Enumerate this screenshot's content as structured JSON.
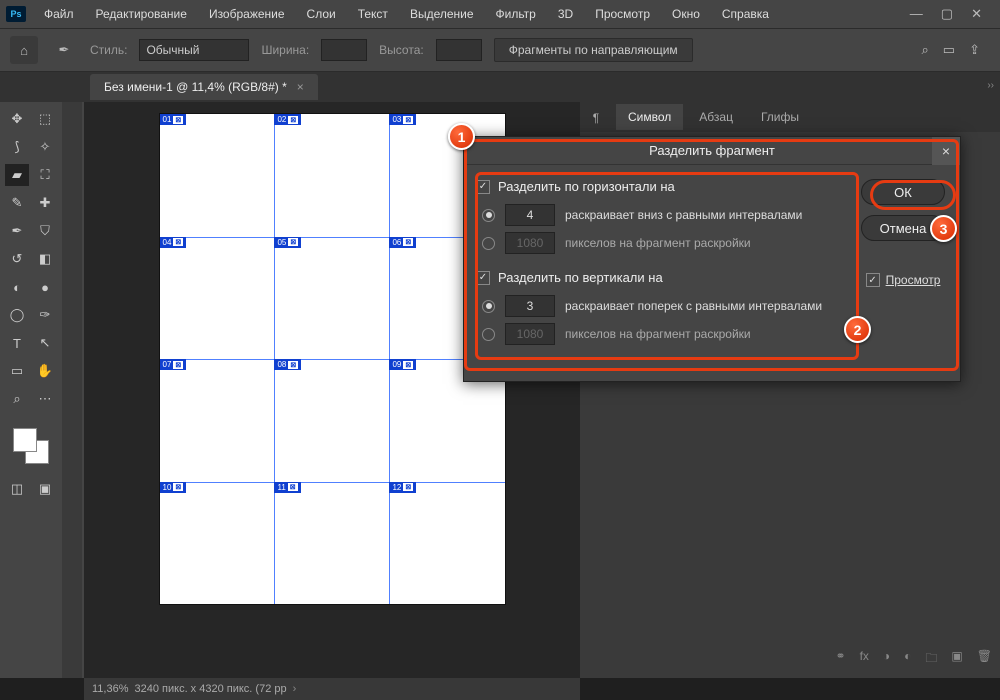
{
  "app": {
    "logo": "Ps"
  },
  "menu": [
    "Файл",
    "Редактирование",
    "Изображение",
    "Слои",
    "Текст",
    "Выделение",
    "Фильтр",
    "3D",
    "Просмотр",
    "Окно",
    "Справка"
  ],
  "options": {
    "style_label": "Стиль:",
    "style_value": "Обычный",
    "width_label": "Ширина:",
    "width_value": "",
    "height_label": "Высота:",
    "height_value": "",
    "slices_btn": "Фрагменты по направляющим"
  },
  "doc_tab": "Без имени-1 @ 11,4% (RGB/8#) *",
  "panel_tabs": [
    "Символ",
    "Абзац",
    "Глифы"
  ],
  "slices": [
    "01",
    "02",
    "03",
    "04",
    "05",
    "06",
    "07",
    "08",
    "09",
    "10",
    "11",
    "12"
  ],
  "dialog": {
    "title": "Разделить фрагмент",
    "h_check": "Разделить по горизонтали на",
    "h_count": "4",
    "h_count_desc": "раскраивает вниз с равными интервалами",
    "h_px": "1080",
    "h_px_desc": "пикселов на фрагмент раскройки",
    "v_check": "Разделить по вертикали на",
    "v_count": "3",
    "v_count_desc": "раскраивает поперек с равными интервалами",
    "v_px": "1080",
    "v_px_desc": "пикселов на фрагмент раскройки",
    "ok": "ОК",
    "cancel": "Отмена",
    "preview": "Просмотр"
  },
  "status": {
    "zoom": "11,36%",
    "dims": "3240 пикс. x 4320 пикс. (72 pp"
  },
  "annotations": [
    "1",
    "2",
    "3"
  ]
}
